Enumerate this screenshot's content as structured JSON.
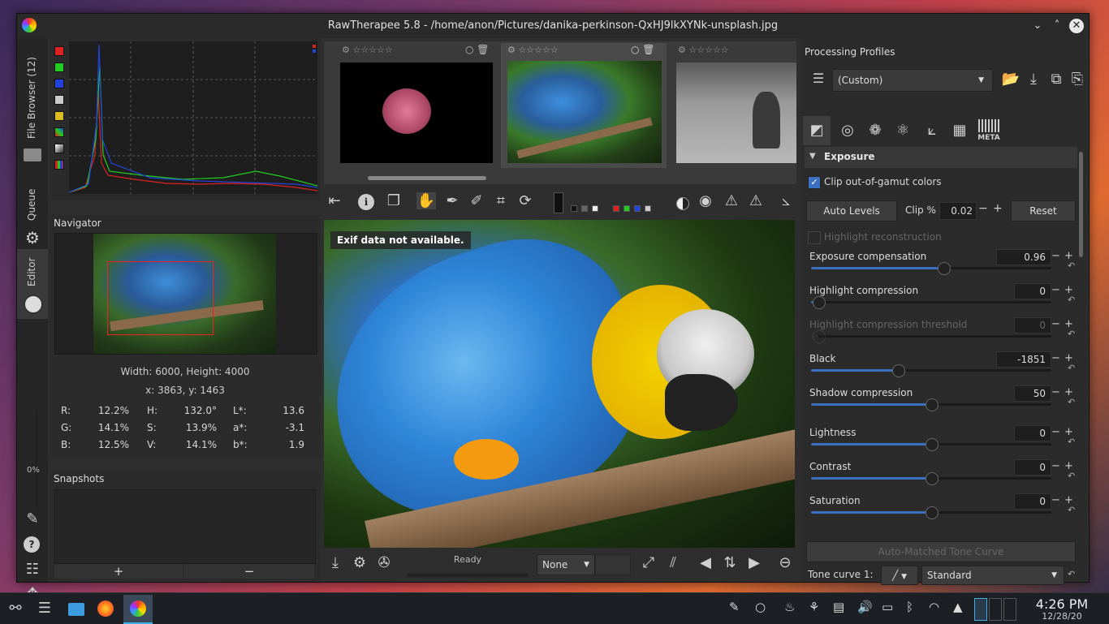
{
  "window": {
    "title": "RawTherapee 5.8 - /home/anon/Pictures/danika-perkinson-QxHJ9lkXYNk-unsplash.jpg",
    "controls": [
      "⌄",
      "˄",
      "✕"
    ]
  },
  "left_tabs": {
    "file_browser": "File Browser (12)",
    "queue": "Queue",
    "editor": "Editor",
    "progress": "0%"
  },
  "navigator": {
    "title": "Navigator",
    "size_text": "Width: 6000, Height: 4000",
    "coords_text": "x: 3863, y: 1463",
    "values": {
      "R_label": "R:",
      "R": "12.2%",
      "G_label": "G:",
      "G": "14.1%",
      "B_label": "B:",
      "B": "12.5%",
      "H_label": "H:",
      "H": "132.0°",
      "S_label": "S:",
      "S": "13.9%",
      "V_label": "V:",
      "V": "14.1%",
      "L_label": "L*:",
      "L": "13.6",
      "a_label": "a*:",
      "a": "-3.1",
      "b_label": "b*:",
      "b": "1.9"
    }
  },
  "snapshots": {
    "title": "Snapshots",
    "add": "+",
    "remove": "−"
  },
  "viewer": {
    "exif_message": "Exif data not available.",
    "status": "Ready",
    "none_select": "None"
  },
  "processing_profiles": {
    "title": "Processing Profiles",
    "selected": "(Custom)"
  },
  "exposure": {
    "section_title": "Exposure",
    "clip_label": "Clip out-of-gamut colors",
    "auto_levels": "Auto Levels",
    "clip_label2": "Clip %",
    "clip_value": "0.02",
    "reset": "Reset",
    "highlight_reconstruction": "Highlight reconstruction",
    "sliders": [
      {
        "label": "Exposure compensation",
        "value": "0.96",
        "pos": 0.55
      },
      {
        "label": "Highlight compression",
        "value": "0",
        "pos": 0.03
      },
      {
        "label": "Highlight compression threshold",
        "value": "0",
        "pos": 0.03
      },
      {
        "label": "Black",
        "value": "-1851",
        "pos": 0.36
      },
      {
        "label": "Shadow compression",
        "value": "50",
        "pos": 0.5
      },
      {
        "label": "Lightness",
        "value": "0",
        "pos": 0.5
      },
      {
        "label": "Contrast",
        "value": "0",
        "pos": 0.5
      },
      {
        "label": "Saturation",
        "value": "0",
        "pos": 0.5
      }
    ],
    "auto_matched": "Auto-Matched Tone Curve",
    "tone_curve_label": "Tone curve 1:",
    "tone_curve_mode": "Standard"
  },
  "tool_tabs": {
    "meta": "META"
  },
  "taskbar": {
    "time": "4:26 PM",
    "date": "12/28/20"
  }
}
